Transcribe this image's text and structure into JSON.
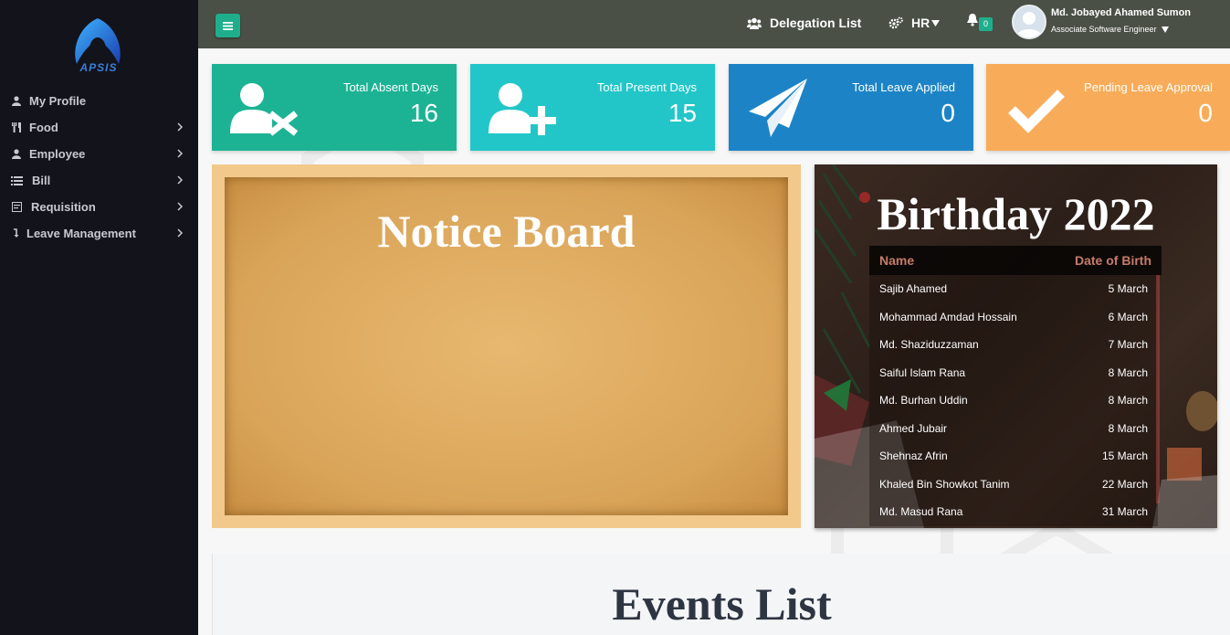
{
  "brand": {
    "logo_text": "APSIS"
  },
  "sidebar": {
    "items": [
      {
        "label": "My Profile",
        "icon": "user-icon",
        "has_submenu": false
      },
      {
        "label": "Food",
        "icon": "cutlery-icon",
        "has_submenu": true
      },
      {
        "label": "Employee",
        "icon": "user-icon",
        "has_submenu": true
      },
      {
        "label": "Bill",
        "icon": "list-icon",
        "has_submenu": true
      },
      {
        "label": "Requisition",
        "icon": "form-icon",
        "has_submenu": true
      },
      {
        "label": "Leave Management",
        "icon": "arrow-down-icon",
        "has_submenu": true
      }
    ]
  },
  "topbar": {
    "delegation_label": "Delegation List",
    "hr_label": "HR",
    "notification_count": "0",
    "user_name": "Md. Jobayed Ahamed Sumon",
    "user_role": "Associate Software Engineer"
  },
  "cards": [
    {
      "label": "Total Absent Days",
      "value": "16",
      "color": "#1cb394",
      "icon": "user-remove-icon"
    },
    {
      "label": "Total Present Days",
      "value": "15",
      "color": "#23c6c8",
      "icon": "user-add-icon"
    },
    {
      "label": "Total Leave Applied",
      "value": "0",
      "color": "#1c84c6",
      "icon": "paper-plane-icon"
    },
    {
      "label": "Pending Leave Approval",
      "value": "0",
      "color": "#f8ac59",
      "icon": "check-icon"
    }
  ],
  "notice_board": {
    "title": "Notice Board"
  },
  "birthday": {
    "title": "Birthday 2022",
    "col_name": "Name",
    "col_dob": "Date of Birth",
    "rows": [
      {
        "name": "Sajib Ahamed",
        "dob": "5 March"
      },
      {
        "name": "Mohammad Amdad Hossain",
        "dob": "6 March"
      },
      {
        "name": "Md. Shaziduzzaman",
        "dob": "7 March"
      },
      {
        "name": "Saiful Islam Rana",
        "dob": "8 March"
      },
      {
        "name": "Md. Burhan Uddin",
        "dob": "8 March"
      },
      {
        "name": "Ahmed Jubair",
        "dob": "8 March"
      },
      {
        "name": "Shehnaz Afrin",
        "dob": "15 March"
      },
      {
        "name": "Khaled Bin Showkot Tanim",
        "dob": "22 March"
      },
      {
        "name": "Md. Masud Rana",
        "dob": "31 March"
      }
    ]
  },
  "events": {
    "title": "Events List"
  }
}
